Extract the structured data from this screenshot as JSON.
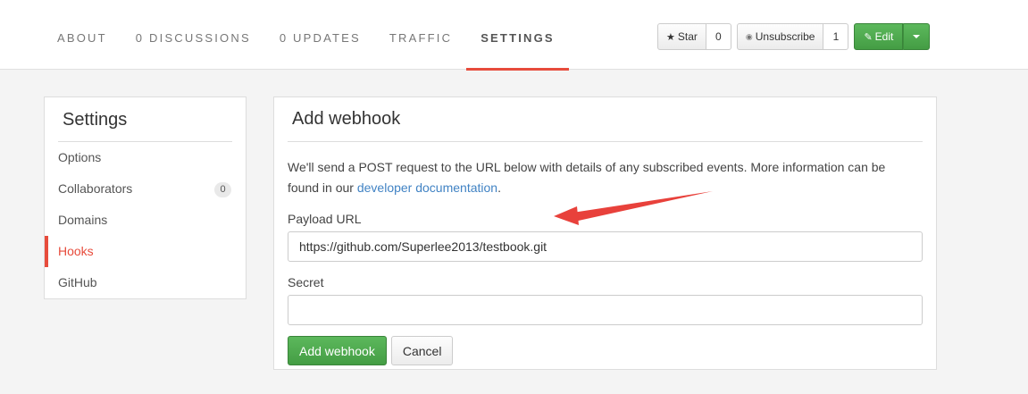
{
  "nav": {
    "tabs": [
      {
        "label": "ABOUT"
      },
      {
        "label": "0 DISCUSSIONS"
      },
      {
        "label": "0 UPDATES"
      },
      {
        "label": "TRAFFIC"
      },
      {
        "label": "SETTINGS",
        "active": true
      }
    ]
  },
  "actions": {
    "star_label": "Star",
    "star_count": "0",
    "unsubscribe_label": "Unsubscribe",
    "unsubscribe_count": "1",
    "edit_label": "Edit"
  },
  "sidebar": {
    "title": "Settings",
    "items": [
      {
        "label": "Options"
      },
      {
        "label": "Collaborators",
        "badge": "0"
      },
      {
        "label": "Domains"
      },
      {
        "label": "Hooks",
        "active": true
      },
      {
        "label": "GitHub"
      }
    ]
  },
  "panel": {
    "title": "Add webhook",
    "description_before": "We'll send a POST request to the URL below with details of any subscribed events. More information can be found in our ",
    "description_link": "developer documentation",
    "description_after": ".",
    "payload_label": "Payload URL",
    "payload_value": "https://github.com/Superlee2013/testbook.git",
    "secret_label": "Secret",
    "secret_value": "",
    "submit_label": "Add webhook",
    "cancel_label": "Cancel"
  },
  "colors": {
    "accent": "#e74c3c",
    "primary_green": "#5cb85c",
    "link": "#4183c4",
    "annotation_arrow": "#e8413b"
  },
  "icons": [
    "star-icon",
    "rss-icon",
    "pencil-icon",
    "caret-down-icon"
  ]
}
